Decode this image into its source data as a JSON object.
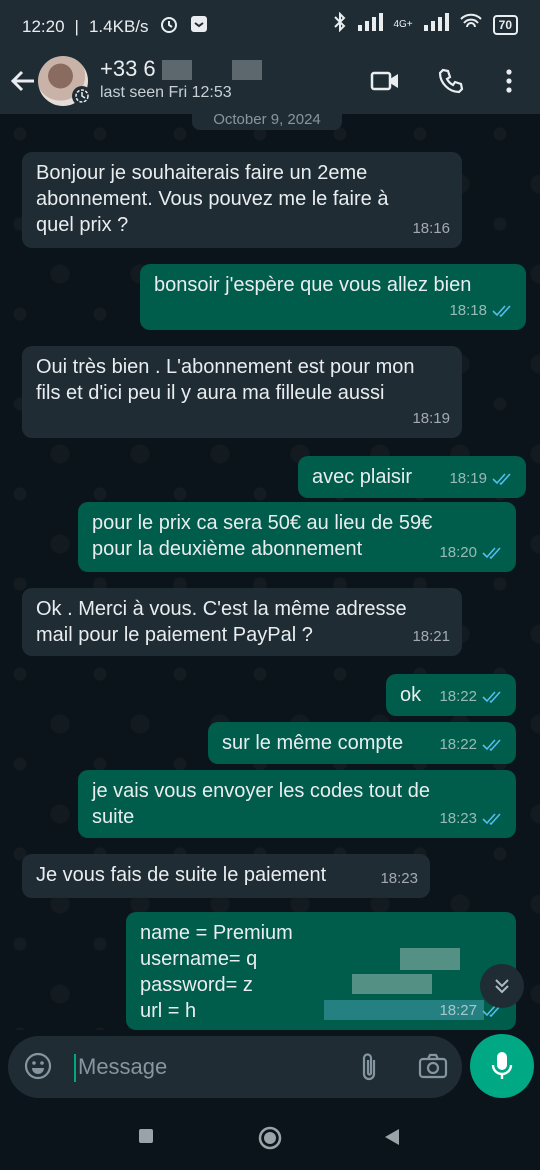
{
  "status_bar": {
    "time": "12:20",
    "speed": "1.4KB/s",
    "network": "4G+",
    "battery": "70"
  },
  "header": {
    "contact_name": "+33 6",
    "last_seen": "last seen Fri 12:53"
  },
  "date_chip": "October 9, 2024",
  "messages": [
    {
      "dir": "in",
      "text": "Bonjour je souhaiterais faire un 2eme\nabonnement. Vous pouvez me le faire à\nquel prix ?",
      "time": "18:16"
    },
    {
      "dir": "out",
      "text": "bonsoir j'espère que vous allez bien",
      "time": "18:18"
    },
    {
      "dir": "in",
      "text": "Oui très bien . L'abonnement est pour mon\nfils et d'ici peu il y aura ma filleule aussi",
      "time": "18:19"
    },
    {
      "dir": "out",
      "text": "avec plaisir",
      "time": "18:19"
    },
    {
      "dir": "out",
      "text": "pour le prix ca sera 50€ au lieu de 59€\npour la deuxième abonnement",
      "time": "18:20"
    },
    {
      "dir": "in",
      "text": "Ok . Merci à vous. C'est la même adresse\nmail pour le paiement PayPal ?",
      "time": "18:21"
    },
    {
      "dir": "out",
      "text": "ok",
      "time": "18:22"
    },
    {
      "dir": "out",
      "text": "sur le même compte",
      "time": "18:22"
    },
    {
      "dir": "out",
      "text": "je vais vous envoyer les codes tout de\nsuite",
      "time": "18:23"
    },
    {
      "dir": "in",
      "text": "Je vous fais de suite le paiement",
      "time": "18:23"
    },
    {
      "dir": "out",
      "text": "name = Premium\nusername= q\npassword= z\nurl = h",
      "time": "18:27"
    }
  ],
  "composer": {
    "placeholder": "Message"
  },
  "colors": {
    "bg": "#0b141a",
    "incoming": "#1f2c34",
    "outgoing": "#005c4b",
    "accent": "#00a884",
    "read_tick": "#53bdeb"
  }
}
